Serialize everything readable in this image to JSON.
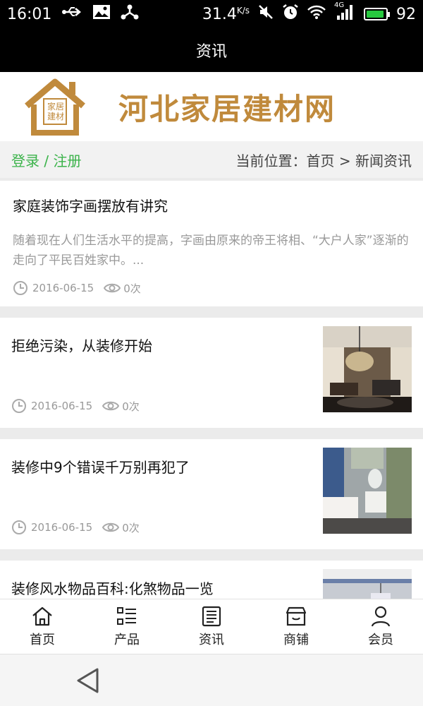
{
  "status_bar": {
    "time": "16:01",
    "network_speed": "31.4",
    "network_unit": "K/s",
    "network_type": "4G",
    "battery_level": "92",
    "battery_fraction": 0.92,
    "icons": [
      "usb-icon",
      "image-icon",
      "share-icon",
      "mute-icon",
      "alarm-icon",
      "wifi-icon",
      "signal-icon",
      "battery-icon"
    ]
  },
  "header": {
    "title": "资讯"
  },
  "banner": {
    "site_name": "河北家居建材网",
    "logo_text": "家居建材",
    "brand_color": "#c08a3c"
  },
  "breadcrumb": {
    "login_register": "登录 / 注册",
    "location": "当前位置：首页 > 新闻资讯",
    "accent_color": "#3bb34a"
  },
  "articles": [
    {
      "title": "家庭装饰字画摆放有讲究",
      "excerpt": "随着现在人们生活水平的提高，字画由原来的帝王将相、“大户人家”逐渐的走向了平民百姓家中。...",
      "date": "2016-06-15",
      "views": "0次"
    },
    {
      "title": "拒绝污染，从装修开始",
      "date": "2016-06-15",
      "views": "0次",
      "thumb": "living-room-chandelier"
    },
    {
      "title": "装修中9个错误千万别再犯了",
      "date": "2016-06-15",
      "views": "0次",
      "thumb": "bedroom-vanity"
    },
    {
      "title": "装修风水物品百科:化煞物品一览",
      "thumb": "ceiling-chandelier"
    }
  ],
  "bottom_nav": [
    {
      "label": "首页",
      "icon": "home-icon"
    },
    {
      "label": "产品",
      "icon": "list-icon"
    },
    {
      "label": "资讯",
      "icon": "news-icon"
    },
    {
      "label": "商铺",
      "icon": "shop-icon"
    },
    {
      "label": "会员",
      "icon": "user-icon"
    }
  ]
}
